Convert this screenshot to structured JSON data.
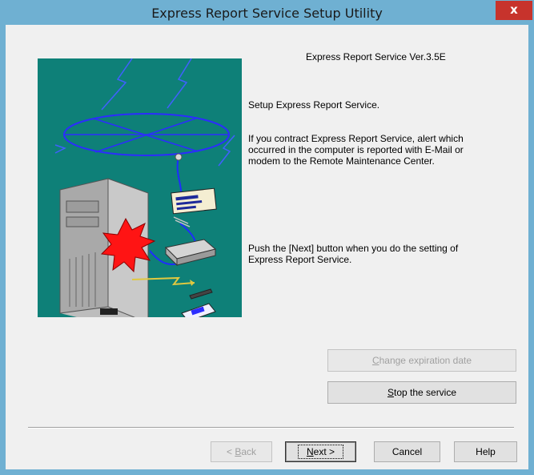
{
  "window": {
    "title": "Express Report Service Setup Utility",
    "close_label": "x"
  },
  "content": {
    "version": "Express Report Service Ver.3.5E",
    "intro": "Setup Express Report Service.",
    "description_lines": [
      "If you contract Express Report Service, alert which",
      "occurred in the computer is reported with E-Mail or",
      "modem to the Remote Maintenance Center."
    ],
    "instruction_lines": [
      "Push the [Next] button when you do the setting of",
      "Express Report Service."
    ]
  },
  "buttons": {
    "change_expiration": {
      "label": "Change expiration date",
      "mnemonic": "C",
      "rest": "hange expiration date",
      "enabled": false
    },
    "stop_service": {
      "label": "Stop the service",
      "mnemonic": "S",
      "rest": "top the service",
      "enabled": true
    },
    "back": {
      "label": "< Back",
      "prefix": "< ",
      "mnemonic": "B",
      "rest": "ack",
      "enabled": false
    },
    "next": {
      "label": "Next >",
      "mnemonic": "N",
      "rest": "ext >",
      "enabled": true,
      "default": true
    },
    "cancel": {
      "label": "Cancel"
    },
    "help": {
      "label": "Help"
    }
  }
}
